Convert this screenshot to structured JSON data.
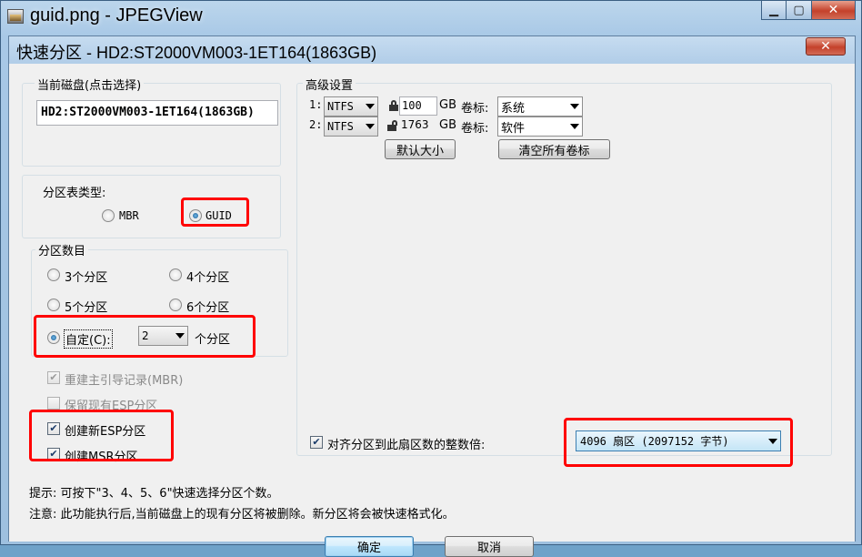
{
  "viewer": {
    "title": "guid.png - JPEGView"
  },
  "dialog": {
    "title": "快速分区 - HD2:ST2000VM003-1ET164(1863GB)"
  },
  "disk": {
    "label": "当前磁盘(点击选择)",
    "value": "HD2:ST2000VM003-1ET164(1863GB)"
  },
  "partition_table": {
    "label": "分区表类型:",
    "options": [
      {
        "label": "MBR",
        "selected": false
      },
      {
        "label": "GUID",
        "selected": true
      }
    ]
  },
  "partition_count": {
    "label": "分区数目",
    "opt3": "3个分区",
    "opt4": "4个分区",
    "opt5": "5个分区",
    "opt6": "6个分区",
    "custom_label": "自定(C):",
    "custom_value": "2",
    "custom_suffix": "个分区",
    "custom_selected": true
  },
  "options": {
    "rebuild_mbr": {
      "label": "重建主引导记录(MBR)",
      "checked": true,
      "enabled": false
    },
    "keep_esp": {
      "label": "保留现有ESP分区",
      "checked": false,
      "enabled": false
    },
    "create_esp": {
      "label": "创建新ESP分区",
      "checked": true,
      "enabled": true
    },
    "create_msr": {
      "label": "创建MSR分区",
      "checked": true,
      "enabled": true
    }
  },
  "advanced": {
    "label": "高级设置",
    "rows": [
      {
        "index": "1:",
        "fs": "NTFS",
        "size": "100",
        "unit": "GB",
        "vol_label_caption": "卷标:",
        "vol_label": "系统",
        "locked": true
      },
      {
        "index": "2:",
        "fs": "NTFS",
        "size": "1763",
        "unit": "GB",
        "vol_label_caption": "卷标:",
        "vol_label": "软件",
        "locked": false
      }
    ],
    "default_size_button": "默认大小",
    "clear_labels_button": "清空所有卷标",
    "align_label": "对齐分区到此扇区数的整数倍:",
    "align_checked": true,
    "align_value": "4096 扇区 (2097152 字节)"
  },
  "hints": {
    "tip": "提示: 可按下\"3、4、5、6\"快速选择分区个数。",
    "note": "注意: 此功能执行后,当前磁盘上的现有分区将被删除。新分区将会被快速格式化。"
  },
  "buttons": {
    "ok": "确定",
    "cancel": "取消"
  },
  "colors": {
    "highlight": "#ff0000",
    "title_bar": "#b9d3ea"
  }
}
